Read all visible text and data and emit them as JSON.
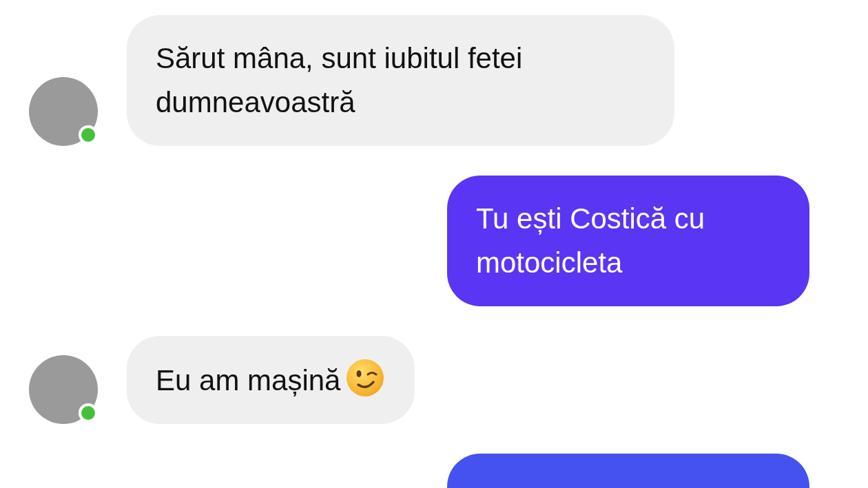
{
  "messages": [
    {
      "kind": "incoming",
      "text": "Sărut mâna, sunt iubitul fetei dumneavoastră",
      "online": true,
      "has_emoji": false
    },
    {
      "kind": "outgoing",
      "text": "Tu ești Costică cu motocicleta",
      "color": "#5a35f4"
    },
    {
      "kind": "incoming",
      "text": "Eu am mașină",
      "online": true,
      "has_emoji": true
    },
    {
      "kind": "outgoing",
      "color": "#4552f0"
    }
  ]
}
